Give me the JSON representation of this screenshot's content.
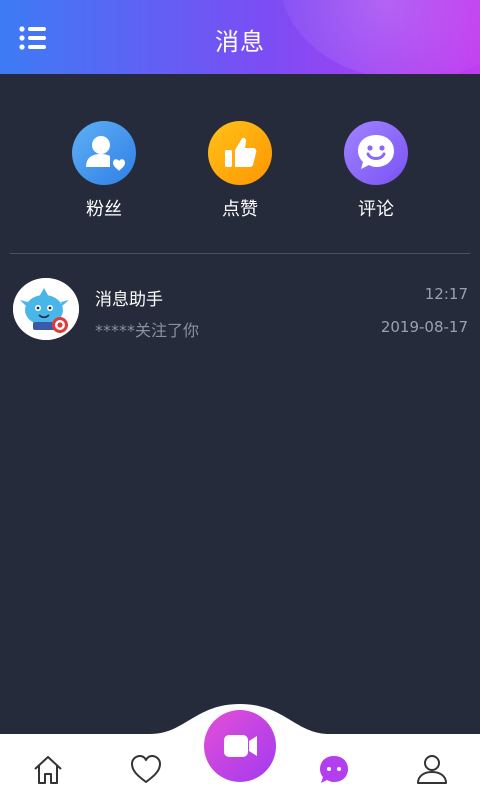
{
  "header": {
    "title": "消息",
    "menu_icon": "list-menu-icon",
    "colors": {
      "gradient_start": "#3d7bf4",
      "gradient_end": "#c23cf0"
    }
  },
  "categories": [
    {
      "label": "粉丝",
      "icon": "fan-user-heart-icon",
      "color": "#3b8ef0"
    },
    {
      "label": "点赞",
      "icon": "thumbs-up-icon",
      "color": "#ffa90a"
    },
    {
      "label": "评论",
      "icon": "smiley-bubble-icon",
      "color": "#8a68fb"
    }
  ],
  "messages": [
    {
      "title": "消息助手",
      "preview": "*****关注了你",
      "time": "12:17",
      "date": "2019-08-17",
      "avatar": "assistant-mascot-avatar"
    }
  ],
  "bottom_nav": {
    "items": [
      {
        "icon": "home-icon",
        "active": false
      },
      {
        "icon": "heart-icon",
        "active": false
      },
      {
        "icon": "video-camera-icon",
        "active": false
      },
      {
        "icon": "message-bubble-icon",
        "active": true
      },
      {
        "icon": "user-icon",
        "active": false
      }
    ],
    "accent_color": "#b33ef0"
  },
  "colors": {
    "background": "#252b3a",
    "muted_text": "#8a90a0"
  }
}
